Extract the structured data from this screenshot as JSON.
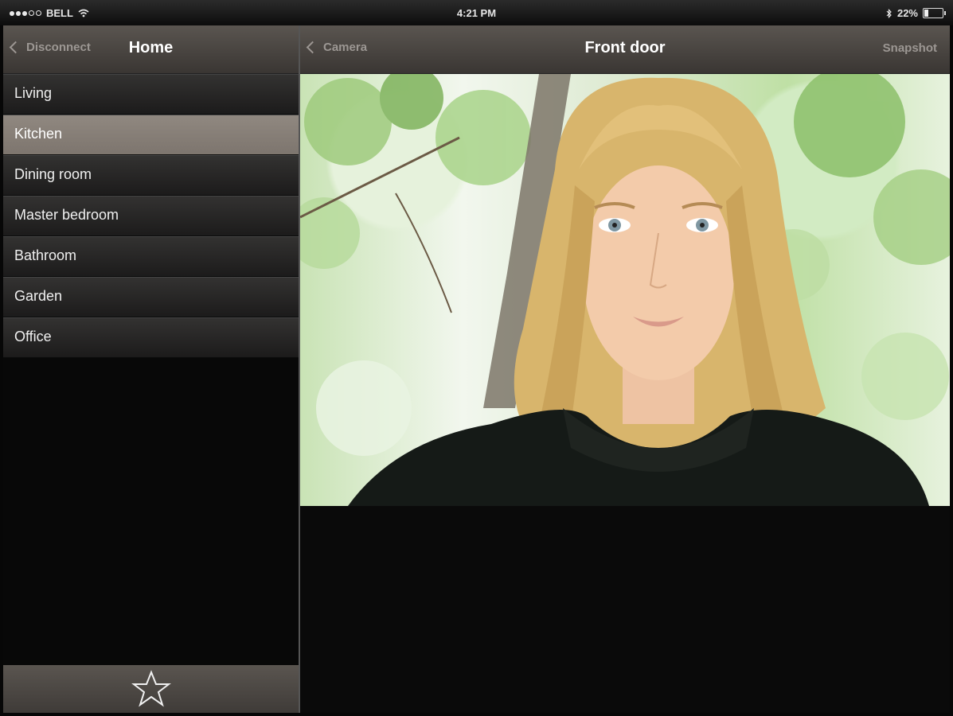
{
  "status_bar": {
    "carrier": "BELL",
    "time": "4:21 PM",
    "battery": "22%",
    "battery_level": 0.22
  },
  "sidebar": {
    "back_label": "Disconnect",
    "title": "Home",
    "items": [
      {
        "label": "Living"
      },
      {
        "label": "Kitchen",
        "selected": true
      },
      {
        "label": "Dining room"
      },
      {
        "label": "Master bedroom"
      },
      {
        "label": "Bathroom"
      },
      {
        "label": "Garden"
      },
      {
        "label": "Office"
      }
    ],
    "footer_icon": "star-icon"
  },
  "main": {
    "back_label": "Camera",
    "title": "Front door",
    "action_label": "Snapshot",
    "image": "camera-feed-photo"
  },
  "colors": {
    "nav_gradient_top": "#5a5550",
    "nav_gradient_bottom": "#3a3633",
    "selected_row": "#857d76",
    "background": "#0a0a0a"
  }
}
